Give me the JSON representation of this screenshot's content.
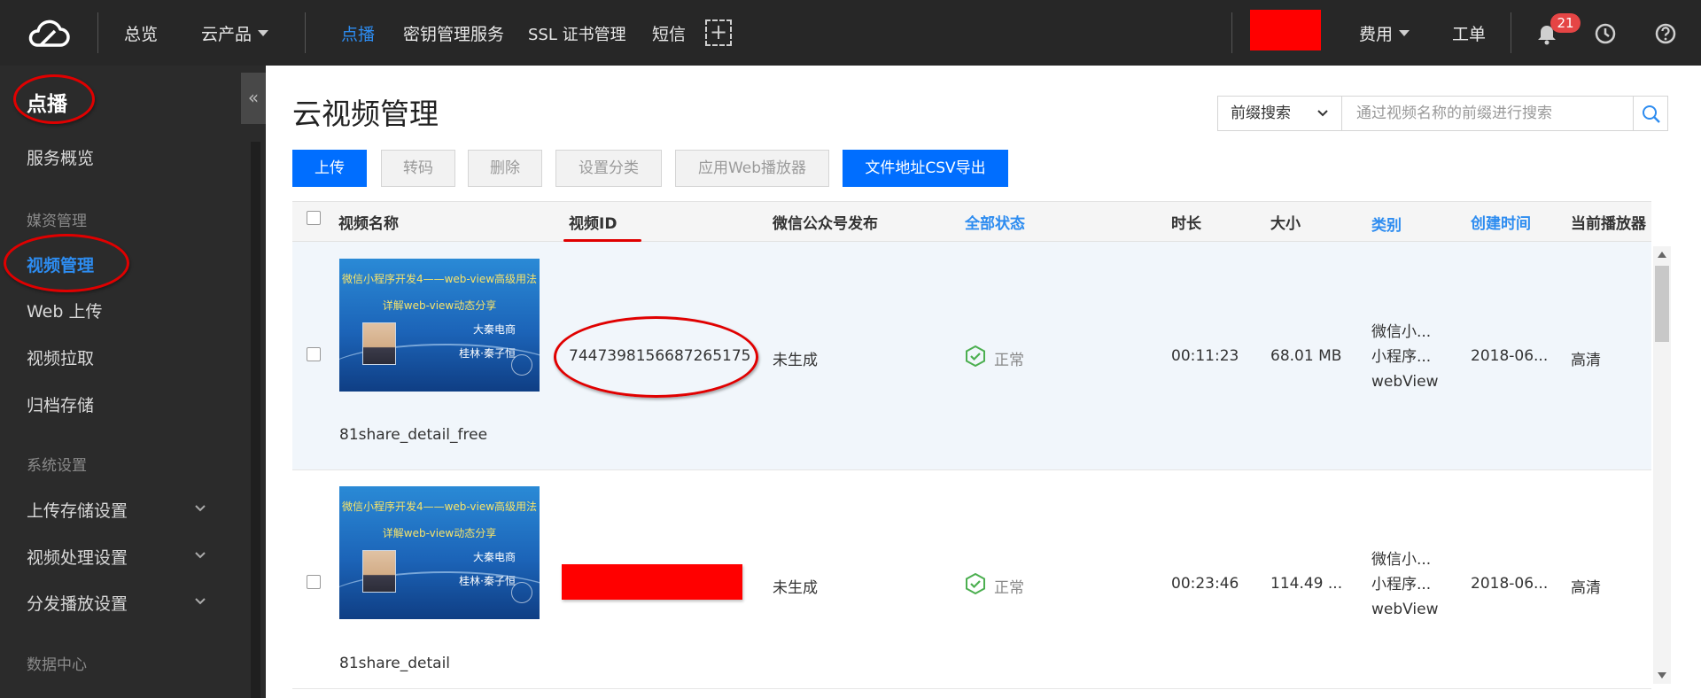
{
  "topnav": {
    "overview": "总览",
    "products": "云产品",
    "vod": "点播",
    "kms": "密钥管理服务",
    "ssl": "SSL 证书管理",
    "sms": "短信",
    "plus": "+",
    "billing": "费用",
    "ticket": "工单",
    "notification_count": "21"
  },
  "sidebar": {
    "title": "点播",
    "overview": "服务概览",
    "group_media": "媒资管理",
    "video_manage": "视频管理",
    "web_upload": "Web 上传",
    "video_pull": "视频拉取",
    "archive": "归档存储",
    "group_system": "系统设置",
    "upload_storage": "上传存储设置",
    "video_processing": "视频处理设置",
    "distribution": "分发播放设置",
    "group_data": "数据中心",
    "collapse_symbol": "«"
  },
  "main": {
    "title": "云视频管理",
    "search_mode": "前缀搜索",
    "search_placeholder": "通过视频名称的前缀进行搜索"
  },
  "toolbar": {
    "upload": "上传",
    "transcode": "转码",
    "delete": "删除",
    "set_category": "设置分类",
    "web_player": "应用Web播放器",
    "export_csv": "文件地址CSV导出"
  },
  "table": {
    "headers": {
      "name": "视频名称",
      "video_id": "视频ID",
      "wechat": "微信公众号发布",
      "status": "全部状态",
      "duration": "时长",
      "size": "大小",
      "category": "类别",
      "created": "创建时间",
      "player": "当前播放器"
    },
    "rows": [
      {
        "thumb_line1": "微信小程序开发4——web-view高级用法",
        "thumb_line2": "详解web-view动态分享",
        "thumb_line3": "大秦电商",
        "thumb_line4": "桂林·秦子恒",
        "file_name": "81share_detail_free",
        "video_id": "7447398156687265175",
        "wechat": "未生成",
        "status": "正常",
        "duration": "00:11:23",
        "size": "68.01 MB",
        "category": [
          "微信小...",
          "小程序...",
          "webView"
        ],
        "created": "2018-06...",
        "player": "高清"
      },
      {
        "thumb_line1": "微信小程序开发4——web-view高级用法",
        "thumb_line2": "详解web-view动态分享",
        "thumb_line3": "大秦电商",
        "thumb_line4": "桂林·秦子恒",
        "file_name": "81share_detail",
        "wechat": "未生成",
        "status": "正常",
        "duration": "00:23:46",
        "size": "114.49 ...",
        "category": [
          "微信小...",
          "小程序...",
          "webView"
        ],
        "created": "2018-06...",
        "player": "高清"
      }
    ]
  },
  "colors": {
    "accent": "#2d8cf0",
    "primary_button": "#006eff",
    "topbar": "#272727",
    "sidebar": "#2b2b2b",
    "annotation_red": "#e00000",
    "status_green": "#4caf50"
  },
  "icons": [
    "cloud-logo-icon",
    "chevron-down-icon",
    "bell-icon",
    "clock-icon",
    "help-icon",
    "search-icon",
    "check-shield-icon",
    "collapse-icon"
  ]
}
